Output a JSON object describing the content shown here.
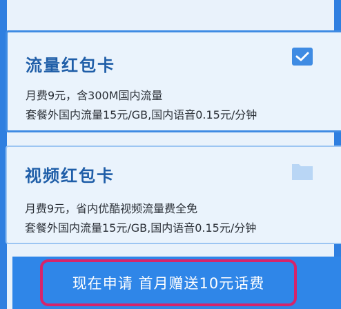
{
  "cards": [
    {
      "title": "流量红包卡",
      "line1": "月费9元，含300M国内流量",
      "line2": "套餐外国内流量15元/GB,国内语音0.15元/分钟",
      "selected": true,
      "icon": "checkmark-icon"
    },
    {
      "title": "视频红包卡",
      "line1": "月费9元，省内优酷视频流量费全免",
      "line2": "套餐外国内流量15元/GB,国内语音0.15元/分钟",
      "selected": false,
      "icon": "folder-icon"
    }
  ],
  "apply_button": {
    "label": "现在申请 首月赠送10元话费"
  },
  "colors": {
    "background": "#2f7fe0",
    "card_bg": "#eaf3fc",
    "title": "#1f5ea8",
    "highlight_border": "#d6246a"
  }
}
